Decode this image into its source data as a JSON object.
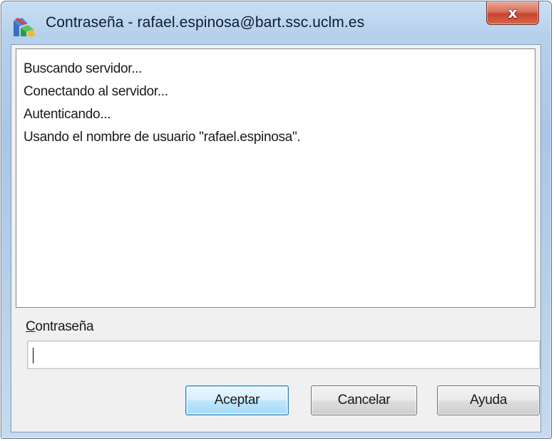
{
  "window": {
    "title": "Contraseña - rafael.espinosa@bart.ssc.uclm.es",
    "close_glyph": "x",
    "app_icon": "network-connection-icon"
  },
  "log": {
    "lines": [
      "Buscando servidor...",
      "Conectando al servidor...",
      "Autenticando...",
      "Usando el nombre de usuario \"rafael.espinosa\"."
    ]
  },
  "password": {
    "label_first_letter": "C",
    "label_rest": "ontraseña",
    "value": "",
    "placeholder": ""
  },
  "buttons": {
    "accept": "Aceptar",
    "cancel": "Cancelar",
    "help": "Ayuda"
  },
  "colors": {
    "default_button_accent": "#3c7fb1",
    "close_button": "#c74530"
  }
}
